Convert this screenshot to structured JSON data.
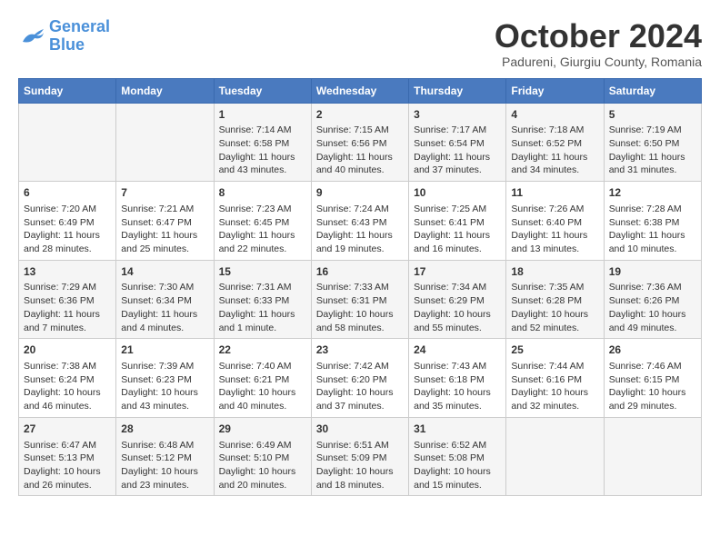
{
  "logo": {
    "line1": "General",
    "line2": "Blue"
  },
  "title": "October 2024",
  "subtitle": "Padureni, Giurgiu County, Romania",
  "days_of_week": [
    "Sunday",
    "Monday",
    "Tuesday",
    "Wednesday",
    "Thursday",
    "Friday",
    "Saturday"
  ],
  "weeks": [
    [
      {
        "day": "",
        "content": ""
      },
      {
        "day": "",
        "content": ""
      },
      {
        "day": "1",
        "content": "Sunrise: 7:14 AM\nSunset: 6:58 PM\nDaylight: 11 hours and 43 minutes."
      },
      {
        "day": "2",
        "content": "Sunrise: 7:15 AM\nSunset: 6:56 PM\nDaylight: 11 hours and 40 minutes."
      },
      {
        "day": "3",
        "content": "Sunrise: 7:17 AM\nSunset: 6:54 PM\nDaylight: 11 hours and 37 minutes."
      },
      {
        "day": "4",
        "content": "Sunrise: 7:18 AM\nSunset: 6:52 PM\nDaylight: 11 hours and 34 minutes."
      },
      {
        "day": "5",
        "content": "Sunrise: 7:19 AM\nSunset: 6:50 PM\nDaylight: 11 hours and 31 minutes."
      }
    ],
    [
      {
        "day": "6",
        "content": "Sunrise: 7:20 AM\nSunset: 6:49 PM\nDaylight: 11 hours and 28 minutes."
      },
      {
        "day": "7",
        "content": "Sunrise: 7:21 AM\nSunset: 6:47 PM\nDaylight: 11 hours and 25 minutes."
      },
      {
        "day": "8",
        "content": "Sunrise: 7:23 AM\nSunset: 6:45 PM\nDaylight: 11 hours and 22 minutes."
      },
      {
        "day": "9",
        "content": "Sunrise: 7:24 AM\nSunset: 6:43 PM\nDaylight: 11 hours and 19 minutes."
      },
      {
        "day": "10",
        "content": "Sunrise: 7:25 AM\nSunset: 6:41 PM\nDaylight: 11 hours and 16 minutes."
      },
      {
        "day": "11",
        "content": "Sunrise: 7:26 AM\nSunset: 6:40 PM\nDaylight: 11 hours and 13 minutes."
      },
      {
        "day": "12",
        "content": "Sunrise: 7:28 AM\nSunset: 6:38 PM\nDaylight: 11 hours and 10 minutes."
      }
    ],
    [
      {
        "day": "13",
        "content": "Sunrise: 7:29 AM\nSunset: 6:36 PM\nDaylight: 11 hours and 7 minutes."
      },
      {
        "day": "14",
        "content": "Sunrise: 7:30 AM\nSunset: 6:34 PM\nDaylight: 11 hours and 4 minutes."
      },
      {
        "day": "15",
        "content": "Sunrise: 7:31 AM\nSunset: 6:33 PM\nDaylight: 11 hours and 1 minute."
      },
      {
        "day": "16",
        "content": "Sunrise: 7:33 AM\nSunset: 6:31 PM\nDaylight: 10 hours and 58 minutes."
      },
      {
        "day": "17",
        "content": "Sunrise: 7:34 AM\nSunset: 6:29 PM\nDaylight: 10 hours and 55 minutes."
      },
      {
        "day": "18",
        "content": "Sunrise: 7:35 AM\nSunset: 6:28 PM\nDaylight: 10 hours and 52 minutes."
      },
      {
        "day": "19",
        "content": "Sunrise: 7:36 AM\nSunset: 6:26 PM\nDaylight: 10 hours and 49 minutes."
      }
    ],
    [
      {
        "day": "20",
        "content": "Sunrise: 7:38 AM\nSunset: 6:24 PM\nDaylight: 10 hours and 46 minutes."
      },
      {
        "day": "21",
        "content": "Sunrise: 7:39 AM\nSunset: 6:23 PM\nDaylight: 10 hours and 43 minutes."
      },
      {
        "day": "22",
        "content": "Sunrise: 7:40 AM\nSunset: 6:21 PM\nDaylight: 10 hours and 40 minutes."
      },
      {
        "day": "23",
        "content": "Sunrise: 7:42 AM\nSunset: 6:20 PM\nDaylight: 10 hours and 37 minutes."
      },
      {
        "day": "24",
        "content": "Sunrise: 7:43 AM\nSunset: 6:18 PM\nDaylight: 10 hours and 35 minutes."
      },
      {
        "day": "25",
        "content": "Sunrise: 7:44 AM\nSunset: 6:16 PM\nDaylight: 10 hours and 32 minutes."
      },
      {
        "day": "26",
        "content": "Sunrise: 7:46 AM\nSunset: 6:15 PM\nDaylight: 10 hours and 29 minutes."
      }
    ],
    [
      {
        "day": "27",
        "content": "Sunrise: 6:47 AM\nSunset: 5:13 PM\nDaylight: 10 hours and 26 minutes."
      },
      {
        "day": "28",
        "content": "Sunrise: 6:48 AM\nSunset: 5:12 PM\nDaylight: 10 hours and 23 minutes."
      },
      {
        "day": "29",
        "content": "Sunrise: 6:49 AM\nSunset: 5:10 PM\nDaylight: 10 hours and 20 minutes."
      },
      {
        "day": "30",
        "content": "Sunrise: 6:51 AM\nSunset: 5:09 PM\nDaylight: 10 hours and 18 minutes."
      },
      {
        "day": "31",
        "content": "Sunrise: 6:52 AM\nSunset: 5:08 PM\nDaylight: 10 hours and 15 minutes."
      },
      {
        "day": "",
        "content": ""
      },
      {
        "day": "",
        "content": ""
      }
    ]
  ]
}
